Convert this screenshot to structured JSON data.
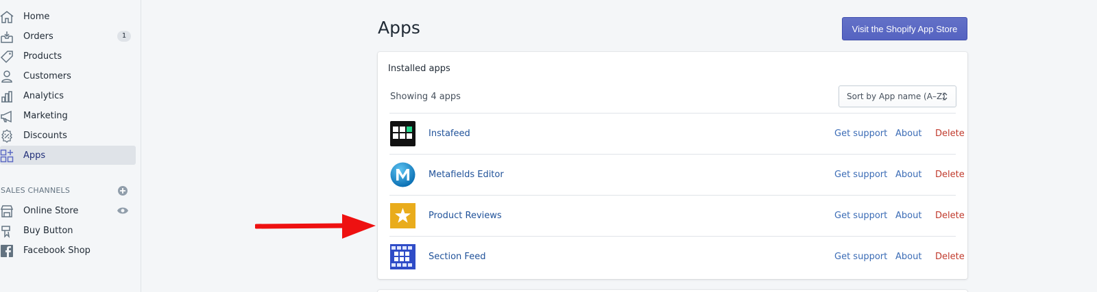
{
  "sidebar": {
    "items": [
      {
        "label": "Home",
        "icon": "home-icon"
      },
      {
        "label": "Orders",
        "icon": "orders-icon",
        "badge": "1"
      },
      {
        "label": "Products",
        "icon": "tag-icon"
      },
      {
        "label": "Customers",
        "icon": "user-icon"
      },
      {
        "label": "Analytics",
        "icon": "analytics-icon"
      },
      {
        "label": "Marketing",
        "icon": "megaphone-icon"
      },
      {
        "label": "Discounts",
        "icon": "discount-icon"
      },
      {
        "label": "Apps",
        "icon": "apps-icon",
        "active": true
      }
    ],
    "sales_channels_header": "SALES CHANNELS",
    "channels": [
      {
        "label": "Online Store",
        "icon": "store-icon"
      },
      {
        "label": "Buy Button",
        "icon": "buy-button-icon"
      },
      {
        "label": "Facebook Shop",
        "icon": "facebook-icon"
      }
    ]
  },
  "main": {
    "title": "Apps",
    "store_button": "Visit the Shopify App Store",
    "card": {
      "title": "Installed apps",
      "showing": "Showing 4 apps",
      "sort_label": "Sort by App name (A–Z)",
      "apps": [
        {
          "name": "Instafeed",
          "support": "Get support",
          "about": "About",
          "delete": "Delete"
        },
        {
          "name": "Metafields Editor",
          "support": "Get support",
          "about": "About",
          "delete": "Delete"
        },
        {
          "name": "Product Reviews",
          "support": "Get support",
          "about": "About",
          "delete": "Delete"
        },
        {
          "name": "Section Feed",
          "support": "Get support",
          "about": "About",
          "delete": "Delete"
        }
      ]
    }
  },
  "colors": {
    "accent": "#5c6ac4",
    "link": "#3a6bb5",
    "delete": "#c0392b",
    "arrow": "#ee1111"
  }
}
